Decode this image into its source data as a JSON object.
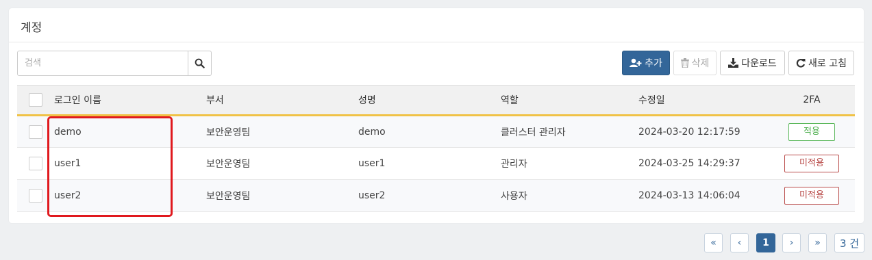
{
  "panel": {
    "title": "계정"
  },
  "toolbar": {
    "search_placeholder": "검색",
    "add_label": "추가",
    "delete_label": "삭제",
    "download_label": "다운로드",
    "refresh_label": "새로 고침"
  },
  "table": {
    "headers": {
      "login": "로그인 이름",
      "dept": "부서",
      "name": "성명",
      "role": "역할",
      "modified": "수정일",
      "twofa": "2FA"
    },
    "rows": [
      {
        "login": "demo",
        "dept": "보안운영팀",
        "name": "demo",
        "role": "클러스터 관리자",
        "modified": "2024-03-20 12:17:59",
        "twofa": "적용"
      },
      {
        "login": "user1",
        "dept": "보안운영팀",
        "name": "user1",
        "role": "관리자",
        "modified": "2024-03-25 14:29:37",
        "twofa": "미적용"
      },
      {
        "login": "user2",
        "dept": "보안운영팀",
        "name": "user2",
        "role": "사용자",
        "modified": "2024-03-13 14:06:04",
        "twofa": "미적용"
      }
    ]
  },
  "pagination": {
    "first": "«",
    "prev": "‹",
    "current": "1",
    "next": "›",
    "last": "»",
    "count": "3 건"
  },
  "colors": {
    "primary": "#336699",
    "header_accent": "#f0c246",
    "highlight": "#e0191e",
    "ok": "#5cb85c",
    "no": "#b94a48"
  }
}
